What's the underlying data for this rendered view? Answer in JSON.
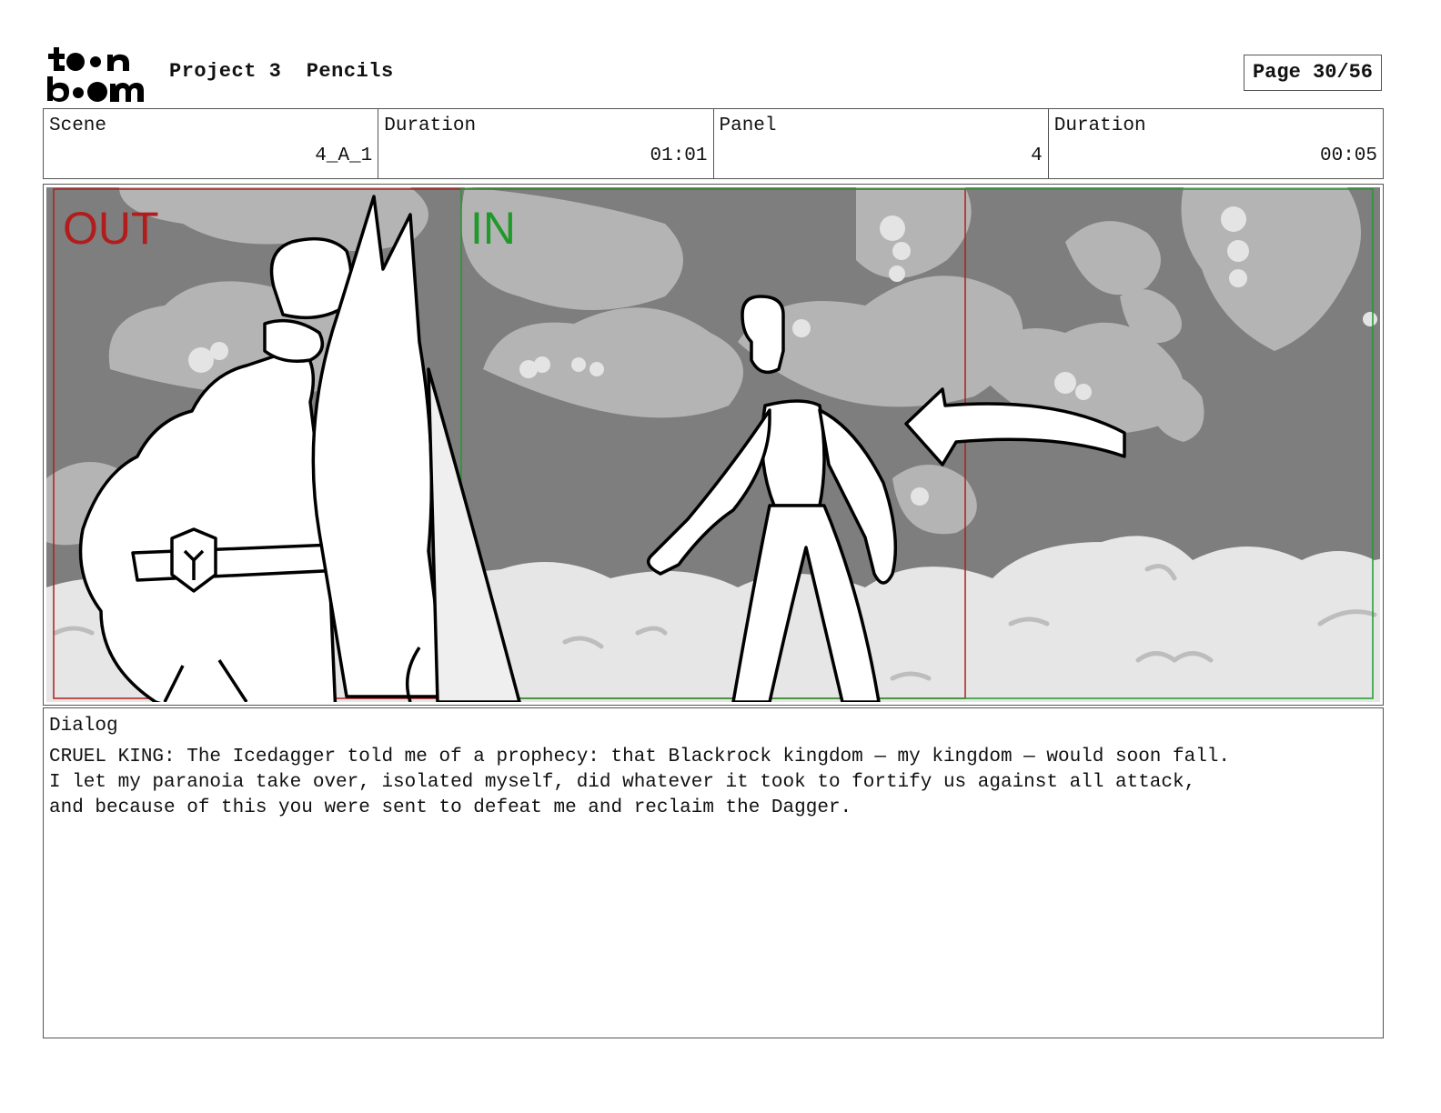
{
  "header": {
    "logo_text": "toon boom",
    "project": "Project 3",
    "stage": "Pencils",
    "page_label": "Page 30/56"
  },
  "info": {
    "scene_label": "Scene",
    "scene_value": "4_A_1",
    "scene_duration_label": "Duration",
    "scene_duration_value": "01:01",
    "panel_label": "Panel",
    "panel_value": "4",
    "panel_duration_label": "Duration",
    "panel_duration_value": "00:05"
  },
  "panel": {
    "out_label": "OUT",
    "in_label": "IN",
    "out_color": "#b11d1d",
    "in_color": "#1f9a2a"
  },
  "dialog": {
    "label": "Dialog",
    "text": "CRUEL KING: The Icedagger told me of a prophecy: that Blackrock kingdom — my kingdom — would soon fall.\nI let my paranoia take over, isolated myself, did whatever it took to fortify us against all attack,\nand because of this you were sent to defeat me and reclaim the Dagger."
  }
}
